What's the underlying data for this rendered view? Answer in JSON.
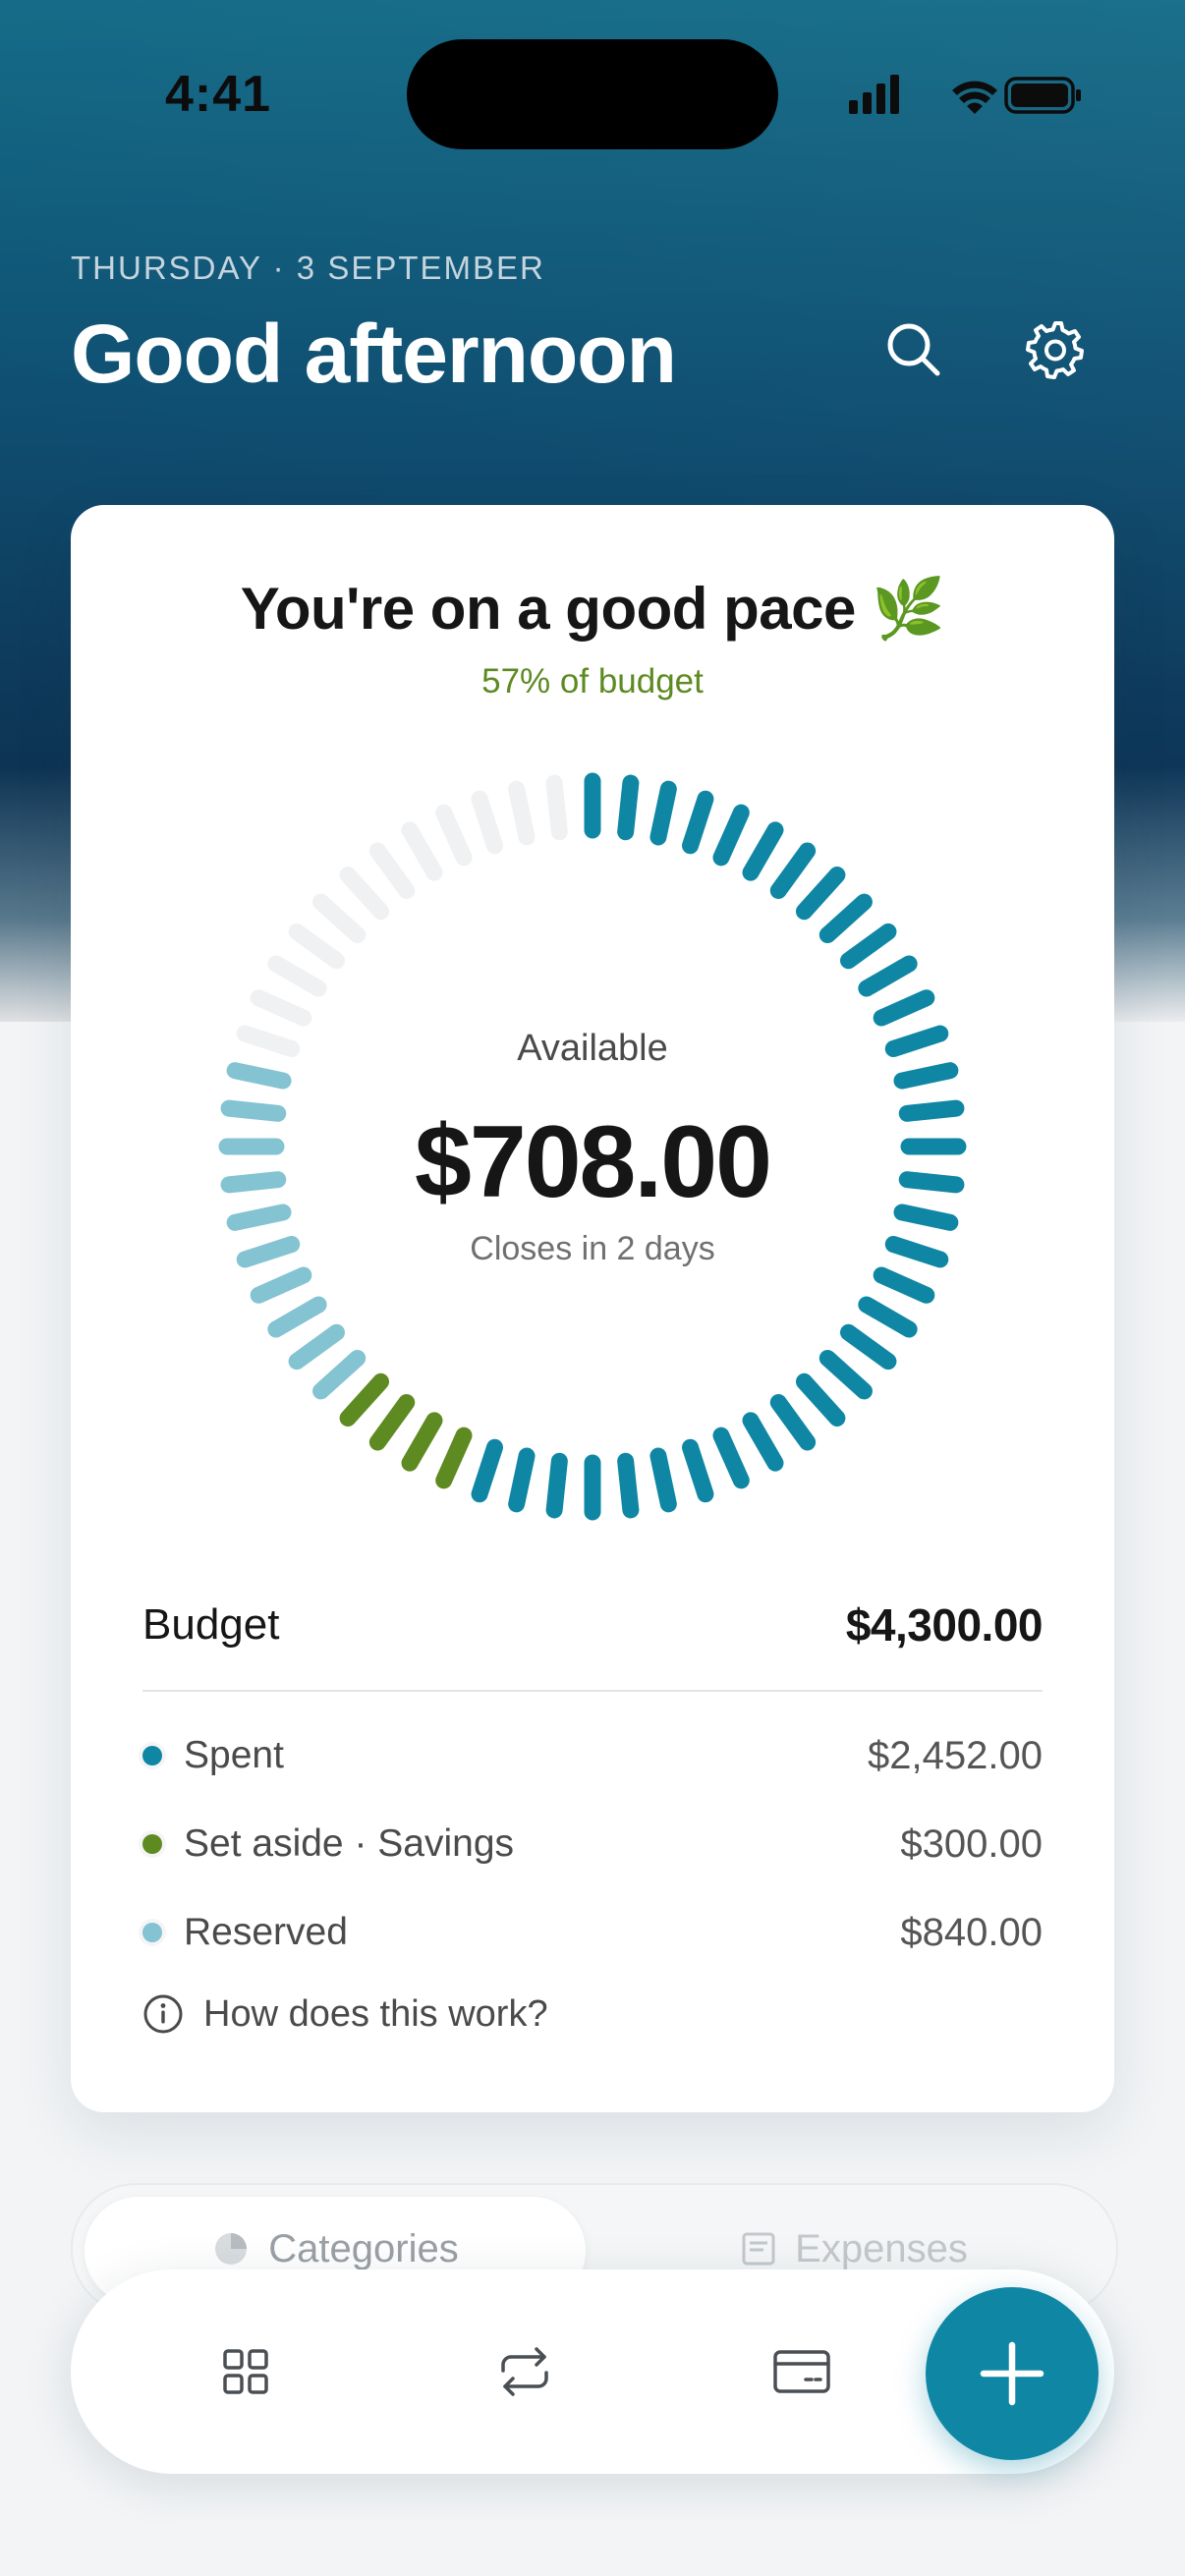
{
  "status_bar": {
    "time": "4:41"
  },
  "header": {
    "date": "THURSDAY · 3 SEPTEMBER",
    "greeting": "Good afternoon"
  },
  "card": {
    "title": "You're on a good pace 🌿",
    "subtitle": "57% of budget",
    "center_label": "Available",
    "center_value": "$708.00",
    "center_note": "Closes in 2 days",
    "budget_label": "Budget",
    "budget_value": "$4,300.00",
    "legend": [
      {
        "label": "Spent",
        "value": "$2,452.00",
        "color": "#0f87a4"
      },
      {
        "label": "Set aside · Savings",
        "value": "$300.00",
        "color": "#5e8a22"
      },
      {
        "label": "Reserved",
        "value": "$840.00",
        "color": "#84c3d2"
      }
    ],
    "help_text": "How does this work?"
  },
  "ring": {
    "total_ticks": 60,
    "spent_ticks": 34,
    "savings_ticks": 4,
    "reserved_ticks": 10,
    "colors": {
      "spent": "#0f87a4",
      "savings": "#5e8a22",
      "reserved": "#84c3d2",
      "empty": "#eff1f2"
    }
  },
  "tabs": [
    {
      "label": "Categories",
      "icon": "pie-chart-icon",
      "active": true
    },
    {
      "label": "Expenses",
      "icon": "receipt-icon",
      "active": false
    }
  ],
  "bottom_nav": [
    {
      "icon": "grid-icon"
    },
    {
      "icon": "repeat-icon"
    },
    {
      "icon": "card-icon"
    },
    {
      "icon": "plus-icon"
    }
  ]
}
